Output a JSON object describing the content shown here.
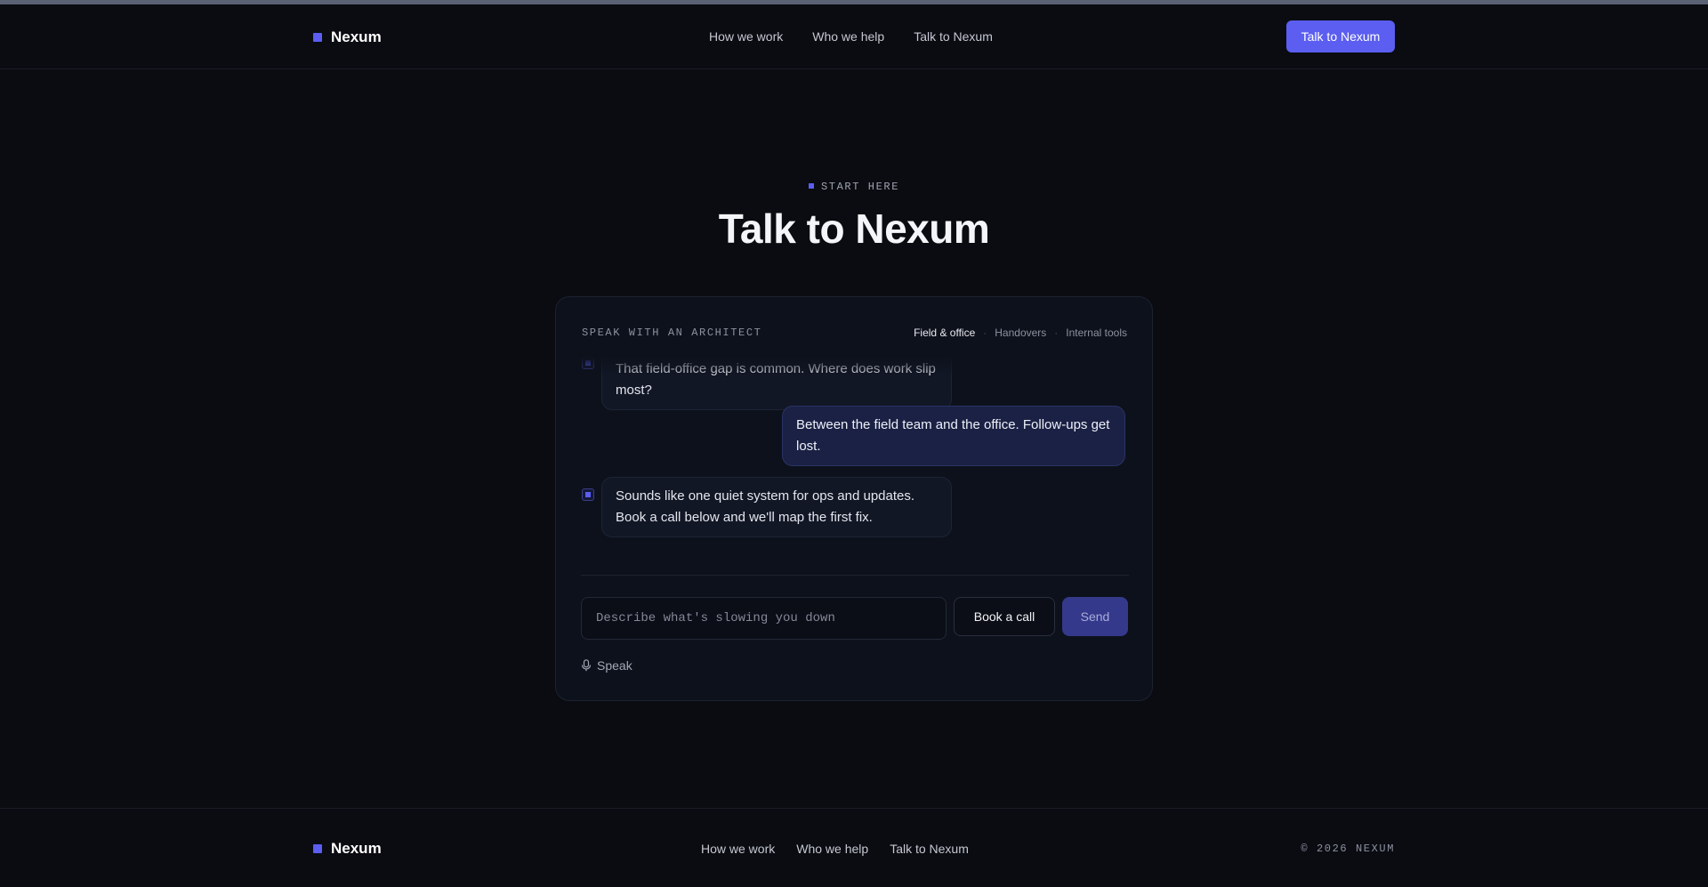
{
  "brand": {
    "name": "Nexum",
    "accent": "#5b5ef0"
  },
  "header": {
    "nav": [
      "How we work",
      "Who we help",
      "Talk to Nexum"
    ],
    "cta_label": "Talk to Nexum"
  },
  "hero": {
    "eyebrow": "START HERE",
    "title": "Talk to Nexum"
  },
  "chat": {
    "label": "SPEAK WITH AN ARCHITECT",
    "topics": [
      "Field & office",
      "Handovers",
      "Internal tools"
    ],
    "active_topic": "Field & office",
    "messages": [
      {
        "role": "assistant",
        "text": "That field-office gap is common. Where does work slip most?"
      },
      {
        "role": "user",
        "text": "Between the field team and the office. Follow-ups get lost."
      },
      {
        "role": "assistant",
        "text": "Sounds like one quiet system for ops and updates. Book a call below and we'll map the first fix."
      }
    ],
    "input_placeholder": "Describe what's slowing you down",
    "book_label": "Book a call",
    "send_label": "Send",
    "speak_label": "Speak",
    "speak_icon": "microphone-icon"
  },
  "footer": {
    "nav": [
      "How we work",
      "Who we help",
      "Talk to Nexum"
    ],
    "copyright": "© 2026 NEXUM"
  }
}
